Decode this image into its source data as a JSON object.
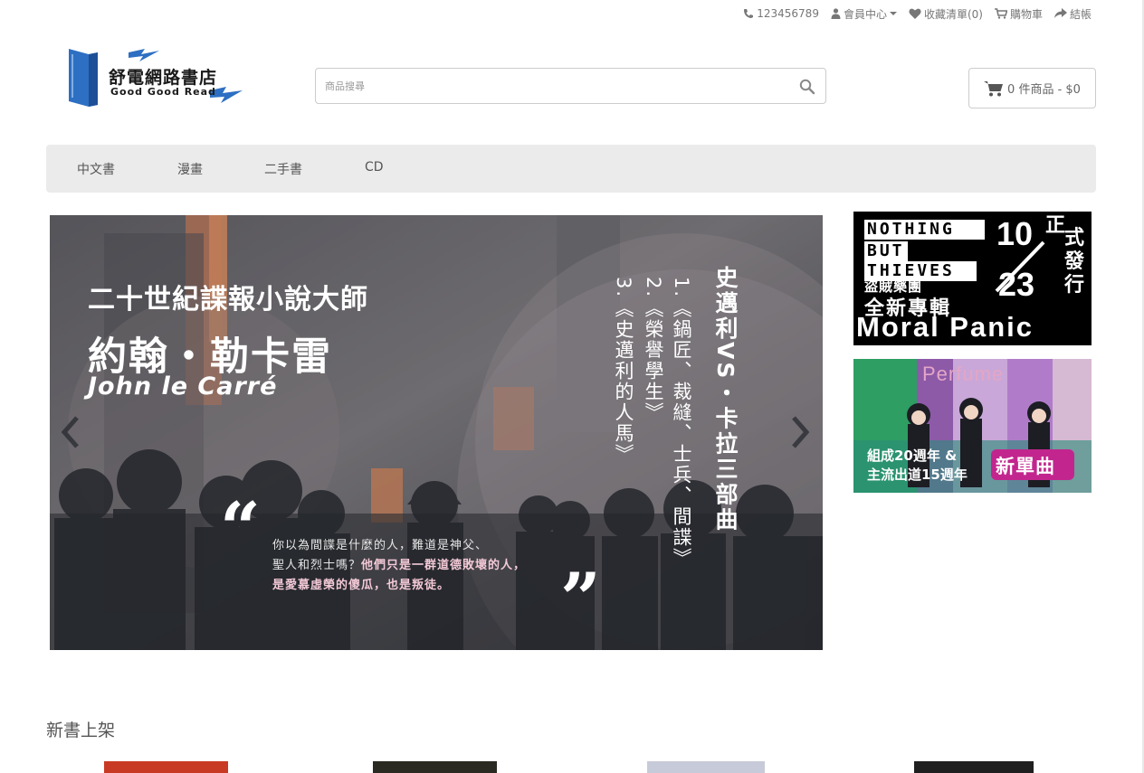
{
  "topbar": {
    "phone": "123456789",
    "account": "會員中心",
    "wishlist": "收藏清單(0)",
    "cart": "購物車",
    "checkout": "結帳"
  },
  "logo": {
    "title": "舒電網路書店",
    "subtitle": "Good Good Read"
  },
  "search": {
    "placeholder": "商品搜尋"
  },
  "cart_button": {
    "label": "0 件商品 - $0"
  },
  "nav": {
    "items": [
      "中文書",
      "漫畫",
      "二手書",
      "CD"
    ]
  },
  "carousel": {
    "subtitle": "二十世紀諜報小說大師",
    "name": "約翰・勒卡雷",
    "name_en": "John le Carré",
    "trilogy_title": "史邁利VS・卡拉三部曲",
    "book1": "1.《鍋匠、裁縫、士兵、間諜》",
    "book2": "2.《榮譽學生》",
    "book3": "3.《史邁利的人馬》",
    "quote_line1": "你以為間諜是什麼的人，難道是神父、",
    "quote_line2_a": "聖人和烈士嗎？",
    "quote_line2_b": "他們只是一群道德敗壞的人，",
    "quote_line3": "是愛慕虛榮的傻瓜，也是叛徒。",
    "open_quote": "“",
    "close_quote": "”"
  },
  "ad1": {
    "band_line1": "NOTHING",
    "band_line2": "BUT",
    "band_line3": "THIEVES",
    "band_cn": "盜賊樂團",
    "album_cn": "全新專輯",
    "album": "Moral Panic",
    "date_month": "10",
    "date_day": "23",
    "release_1": "正",
    "release_2": "式",
    "release_3": "發",
    "release_4": "行"
  },
  "ad2": {
    "artist": "Perfume",
    "line1": "組成20週年 &",
    "line2": "主流出道15週年",
    "badge": "新單曲"
  },
  "new_books": {
    "title": "新書上架"
  }
}
